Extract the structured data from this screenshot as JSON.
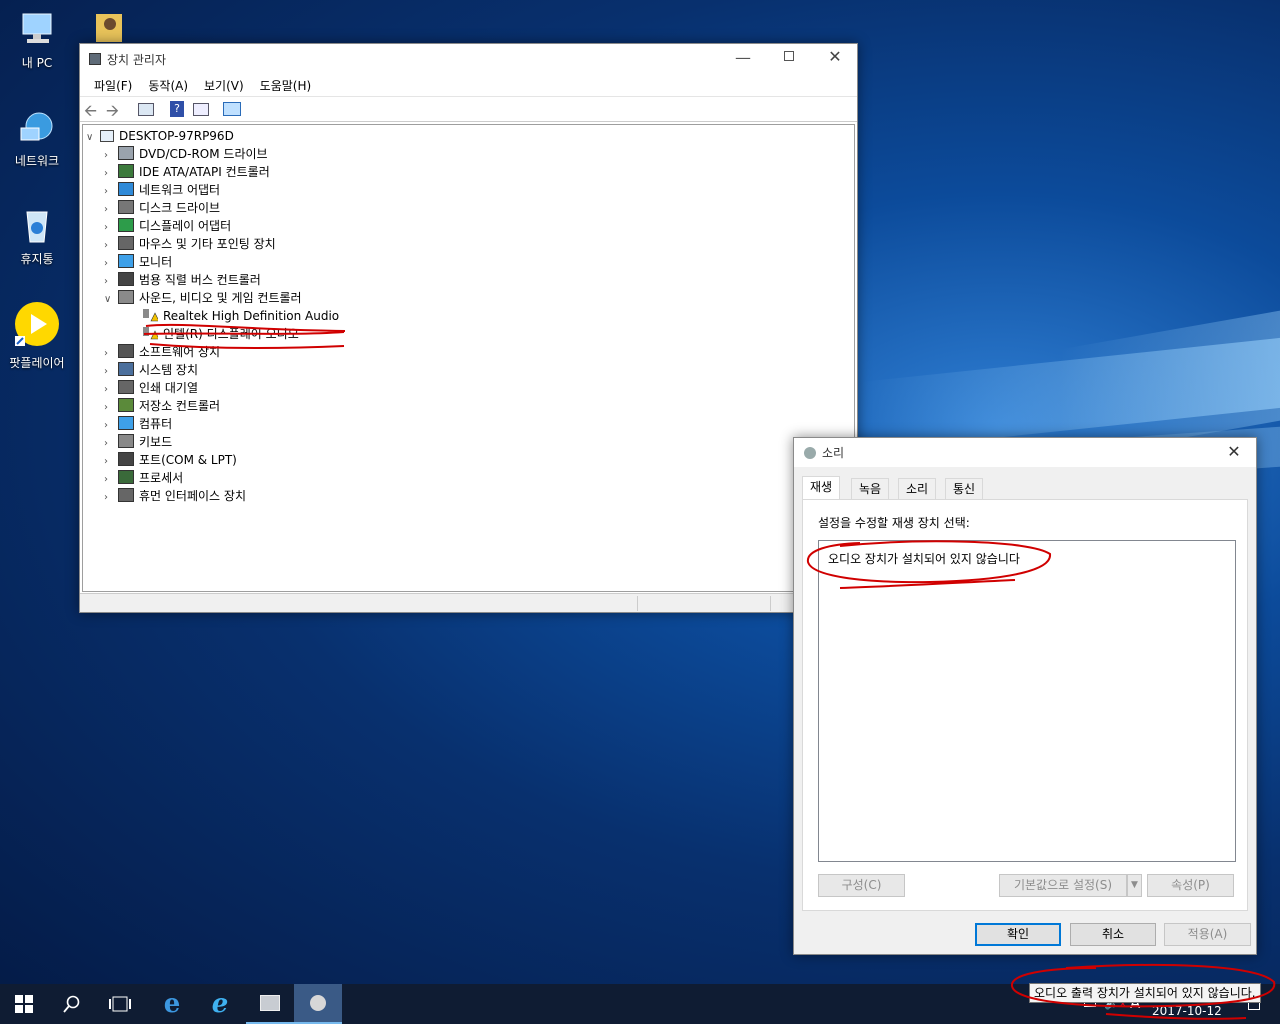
{
  "desktop": {
    "icons": [
      {
        "label": "내 PC"
      },
      {
        "label": "네트워크"
      },
      {
        "label": "휴지통"
      },
      {
        "label": "팟플레이어"
      }
    ]
  },
  "device_manager": {
    "title": "장치 관리자",
    "menu": [
      "파일(F)",
      "동작(A)",
      "보기(V)",
      "도움말(H)"
    ],
    "root": "DESKTOP-97RP96D",
    "items": [
      {
        "label": "DVD/CD-ROM 드라이브",
        "icon": "dvd-drive-icon"
      },
      {
        "label": "IDE ATA/ATAPI 컨트롤러",
        "icon": "ide-controller-icon"
      },
      {
        "label": "네트워크 어댑터",
        "icon": "network-adapter-icon"
      },
      {
        "label": "디스크 드라이브",
        "icon": "disk-drive-icon"
      },
      {
        "label": "디스플레이 어댑터",
        "icon": "display-adapter-icon"
      },
      {
        "label": "마우스 및 기타 포인팅 장치",
        "icon": "mouse-icon"
      },
      {
        "label": "모니터",
        "icon": "monitor-icon"
      },
      {
        "label": "범용 직렬 버스 컨트롤러",
        "icon": "usb-icon"
      },
      {
        "label": "사운드, 비디오 및 게임 컨트롤러",
        "icon": "speaker-icon"
      },
      {
        "label": "Realtek High Definition Audio",
        "icon": "warning-speaker-icon"
      },
      {
        "label": "인텔(R) 디스플레이 오디오",
        "icon": "warning-speaker-icon"
      },
      {
        "label": "소프트웨어 장치",
        "icon": "software-device-icon"
      },
      {
        "label": "시스템 장치",
        "icon": "system-device-icon"
      },
      {
        "label": "인쇄 대기열",
        "icon": "printer-icon"
      },
      {
        "label": "저장소 컨트롤러",
        "icon": "storage-controller-icon"
      },
      {
        "label": "컴퓨터",
        "icon": "computer-icon"
      },
      {
        "label": "키보드",
        "icon": "keyboard-icon"
      },
      {
        "label": "포트(COM & LPT)",
        "icon": "port-icon"
      },
      {
        "label": "프로세서",
        "icon": "processor-icon"
      },
      {
        "label": "휴먼 인터페이스 장치",
        "icon": "hid-icon"
      }
    ]
  },
  "sound_dialog": {
    "title": "소리",
    "tabs": [
      "재생",
      "녹음",
      "소리",
      "통신"
    ],
    "instruction": "설정을 수정할 재생 장치 선택:",
    "empty_message": "오디오 장치가 설치되어 있지 않습니다",
    "buttons": {
      "configure": "구성(C)",
      "set_default": "기본값으로 설정(S)",
      "properties": "속성(P)",
      "ok": "확인",
      "cancel": "취소",
      "apply": "적용(A)"
    }
  },
  "tray": {
    "tooltip": "오디오 출력 장치가 설치되어 있지 않습니다.",
    "ime": "A",
    "date": "2017-10-12"
  },
  "colors": {
    "accent": "#0078d7",
    "annotation": "#d00000",
    "taskbar": "#0f1c33"
  }
}
